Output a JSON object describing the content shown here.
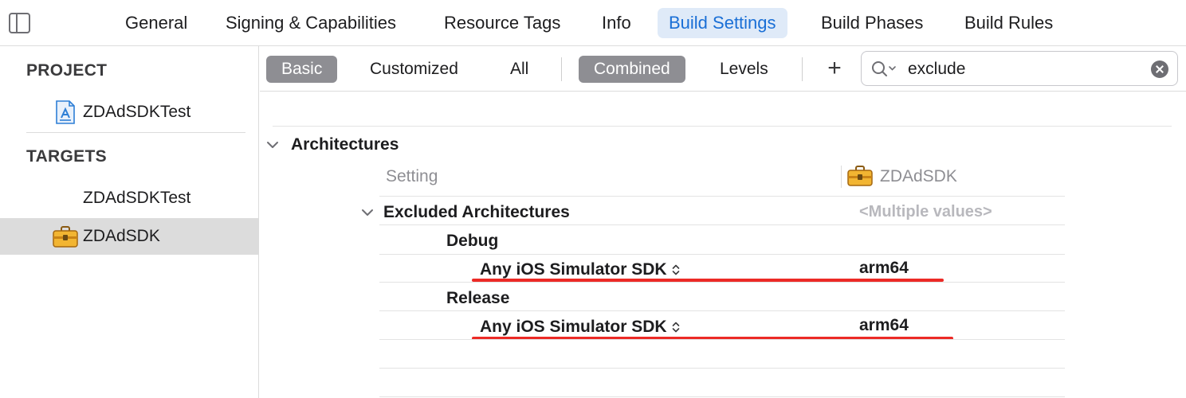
{
  "tabs": [
    {
      "label": "General",
      "active": false
    },
    {
      "label": "Signing & Capabilities",
      "active": false
    },
    {
      "label": "Resource Tags",
      "active": false
    },
    {
      "label": "Info",
      "active": false
    },
    {
      "label": "Build Settings",
      "active": true
    },
    {
      "label": "Build Phases",
      "active": false
    },
    {
      "label": "Build Rules",
      "active": false
    }
  ],
  "navigator": {
    "project_heading": "PROJECT",
    "project_item": "ZDAdSDKTest",
    "targets_heading": "TARGETS",
    "targets": [
      {
        "label": "ZDAdSDKTest",
        "icon": "none",
        "selected": false
      },
      {
        "label": "ZDAdSDK",
        "icon": "toolbox-icon",
        "selected": true
      }
    ]
  },
  "filter": {
    "scope": [
      "Basic",
      "Customized",
      "All"
    ],
    "scope_selected": "Basic",
    "view": [
      "Combined",
      "Levels"
    ],
    "view_selected": "Combined",
    "add_label": "+",
    "search_value": "exclude"
  },
  "settings": {
    "section_title": "Architectures",
    "column_setting": "Setting",
    "column_target": "ZDAdSDK",
    "setting_name": "Excluded Architectures",
    "setting_value": "<Multiple values>",
    "configurations": [
      {
        "name": "Debug",
        "condition": "Any iOS Simulator SDK",
        "value": "arm64"
      },
      {
        "name": "Release",
        "condition": "Any iOS Simulator SDK",
        "value": "arm64"
      }
    ]
  },
  "colors": {
    "accent": "#1a6fd6",
    "tab_active_bg": "#dfeaf8",
    "segment_on_bg": "#8e8e93",
    "annotation_red": "#ec2a26",
    "selection_bg": "#dcdcdc"
  }
}
